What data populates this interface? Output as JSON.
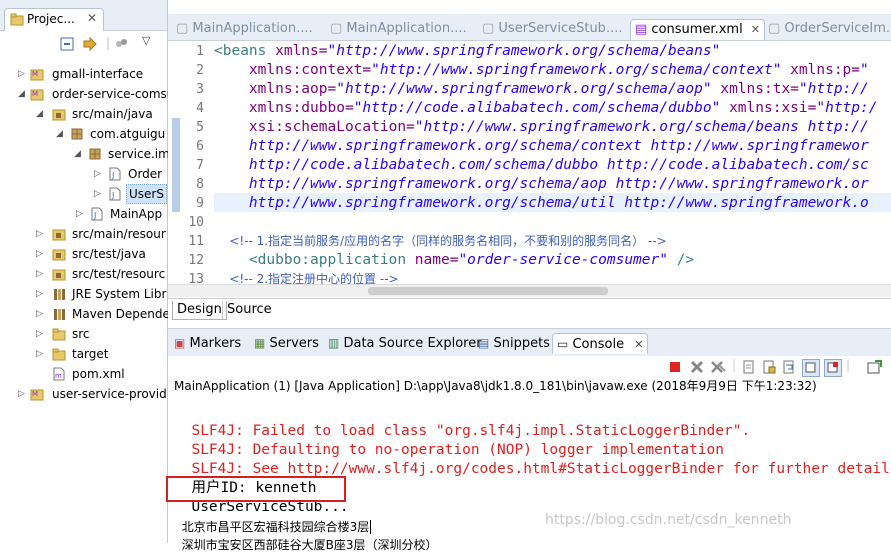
{
  "project_explorer": {
    "tab_label": "Projec...",
    "tree": [
      {
        "label": "gmall-interface"
      },
      {
        "label": "order-service-comsu"
      },
      {
        "label": "src/main/java"
      },
      {
        "label": "com.atguigu"
      },
      {
        "label": "service.im"
      },
      {
        "label": "Order"
      },
      {
        "label": "UserS"
      },
      {
        "label": "MainApp"
      },
      {
        "label": "src/main/resour"
      },
      {
        "label": "src/test/java"
      },
      {
        "label": "src/test/resourc"
      },
      {
        "label": "JRE System Libr"
      },
      {
        "label": "Maven Depende"
      },
      {
        "label": "src"
      },
      {
        "label": "target"
      },
      {
        "label": "pom.xml"
      },
      {
        "label": "user-service-provid"
      }
    ]
  },
  "editor": {
    "tabs": [
      {
        "label": "MainApplication...."
      },
      {
        "label": "MainApplication...."
      },
      {
        "label": "UserServiceStub...."
      },
      {
        "label": "consumer.xml"
      },
      {
        "label": "OrderServiceIm..."
      }
    ],
    "line_numbers": [
      "1",
      "2",
      "3",
      "4",
      "5",
      "6",
      "7",
      "8",
      "9",
      "10",
      "11",
      "12",
      "13"
    ],
    "lines": [
      {
        "tag": "<beans",
        "a1": " xmlns=",
        "v1": "\"http://www.springframework.org/schema/beans\""
      },
      {
        "a1": "    xmlns:context=",
        "v1": "\"http://www.springframework.org/schema/context\"",
        "a2": " xmlns:p=",
        "v2": "\""
      },
      {
        "a1": "    xmlns:aop=",
        "v1": "\"http://www.springframework.org/schema/aop\"",
        "a2": " xmlns:tx=",
        "v2": "\"http://"
      },
      {
        "a1": "    xmlns:dubbo=",
        "v1": "\"http://code.alibabatech.com/schema/dubbo\"",
        "a2": " xmlns:xsi=",
        "v2": "\"http:/"
      },
      {
        "a1": "    xsi:schemaLocation=",
        "v1": "\"http://www.springframework.org/schema/beans http://"
      },
      {
        "v1": "    http://www.springframework.org/schema/context http://www.springframewor"
      },
      {
        "v1": "    http://code.alibabatech.com/schema/dubbo http://code.alibabatech.com/sc"
      },
      {
        "v1": "    http://www.springframework.org/schema/aop http://www.springframework.or"
      },
      {
        "v1": "    http://www.springframework.org/schema/util http://www.springframework.o"
      },
      {
        "plain": ""
      },
      {
        "c": "    <!-- 1.指定当前服务/应用的名字（同样的服务名相同，不要和别的服务同名） -->"
      },
      {
        "tag": "    <dubbo:application",
        "a1": " name=",
        "v1": "\"order-service-comsumer\"",
        "tag2": " />"
      },
      {
        "c": "    <!-- 2.指定注册中心的位置 -->"
      }
    ]
  },
  "design_tabs": {
    "design": "Design",
    "source": "Source"
  },
  "console": {
    "tabs": [
      {
        "label": "Markers"
      },
      {
        "label": "Servers"
      },
      {
        "label": "Data Source Explorer"
      },
      {
        "label": "Snippets"
      },
      {
        "label": "Console"
      }
    ],
    "header": "MainApplication (1) [Java Application] D:\\app\\Java8\\jdk1.8.0_181\\bin\\javaw.exe (2018年9月9日 下午1:23:32)",
    "lines": [
      "SLF4J: Failed to load class \"org.slf4j.impl.StaticLoggerBinder\".",
      "SLF4J: Defaulting to no-operation (NOP) logger implementation",
      "SLF4J: See http://www.slf4j.org/codes.html#StaticLoggerBinder for further detail",
      "用户ID: kenneth",
      "UserServiceStub...",
      "北京市昌平区宏福科技园综合楼3层",
      "深圳市宝安区西部硅谷大厦B座3层（深圳分校）"
    ]
  },
  "watermark": "https://blog.csdn.net/csdn_kenneth",
  "colors": {
    "error": "#e02020",
    "highlight_box": "#d81e1e",
    "tag": "#3f7f7f",
    "attr": "#7f007f",
    "value": "#2a00ff",
    "comment": "#3f5fbf"
  }
}
